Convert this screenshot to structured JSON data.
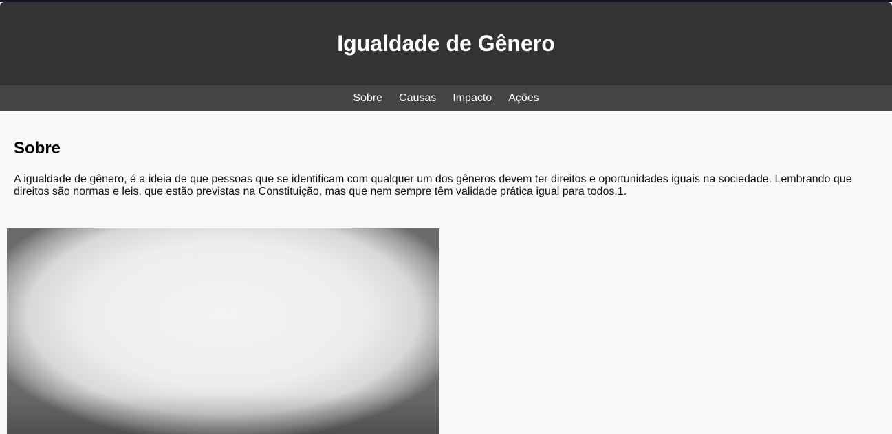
{
  "header": {
    "title": "Igualdade de Gênero"
  },
  "nav": {
    "items": [
      {
        "label": "Sobre"
      },
      {
        "label": "Causas"
      },
      {
        "label": "Impacto"
      },
      {
        "label": "Ações"
      }
    ]
  },
  "about": {
    "heading": "Sobre",
    "text": "A igualdade de gênero, é a ideia de que pessoas que se identificam com qualquer um dos gêneros devem ter direitos e oportunidades iguais na sociedade. Lembrando que direitos são normas e leis, que estão previstas na Constituição, mas que nem sempre têm validade prática igual para todos.1."
  },
  "colors": {
    "header_bg": "#333333",
    "nav_bg": "#444444",
    "page_bg": "#f8f8f8",
    "text_light": "#ffffff"
  }
}
